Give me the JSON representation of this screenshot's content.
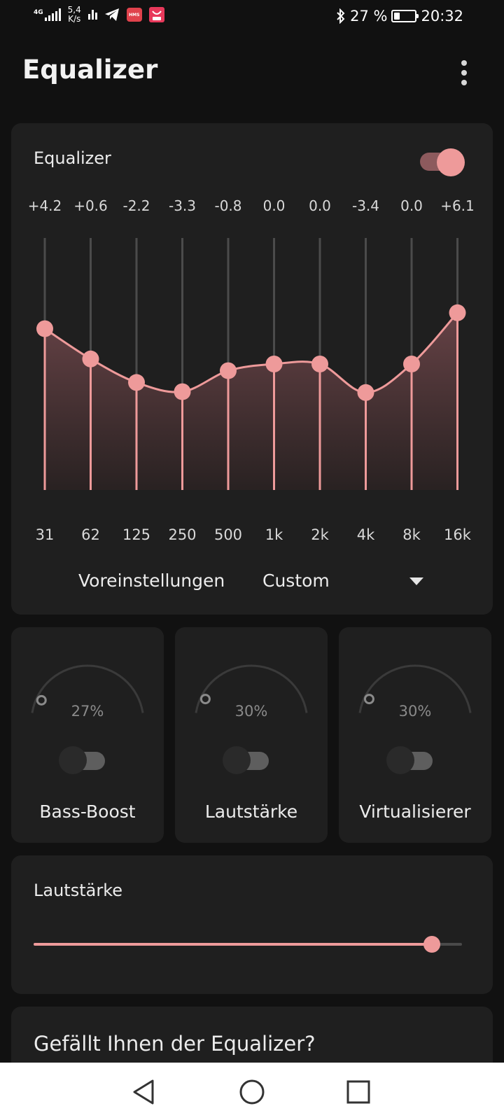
{
  "status_bar": {
    "network_type": "4G",
    "speed_value": "5,4",
    "speed_unit": "K/s",
    "hms_badge": "HMS",
    "battery_text": "27 %",
    "battery_level": 0.27,
    "time": "20:32",
    "icons": [
      "signal-icon",
      "wifi-bars-icon",
      "telegram-icon",
      "hms-icon",
      "shopping-bag-icon",
      "bluetooth-icon",
      "battery-icon"
    ]
  },
  "header": {
    "title": "Equalizer",
    "menu_icon": "more-vertical-icon"
  },
  "equalizer": {
    "title": "Equalizer",
    "enabled": true,
    "range_db": [
      -15,
      15
    ],
    "bands": [
      {
        "freq": "31",
        "value": 4.2,
        "label": "+4.2"
      },
      {
        "freq": "62",
        "value": 0.6,
        "label": "+0.6"
      },
      {
        "freq": "125",
        "value": -2.2,
        "label": "-2.2"
      },
      {
        "freq": "250",
        "value": -3.3,
        "label": "-3.3"
      },
      {
        "freq": "500",
        "value": -0.8,
        "label": "-0.8"
      },
      {
        "freq": "1k",
        "value": 0.0,
        "label": "0.0"
      },
      {
        "freq": "2k",
        "value": 0.0,
        "label": "0.0"
      },
      {
        "freq": "4k",
        "value": -3.4,
        "label": "-3.4"
      },
      {
        "freq": "8k",
        "value": 0.0,
        "label": "0.0"
      },
      {
        "freq": "16k",
        "value": 6.1,
        "label": "+6.1"
      }
    ],
    "preset_label": "Voreinstellungen",
    "preset_value": "Custom"
  },
  "effects": [
    {
      "label": "Bass-Boost",
      "percent_text": "27%",
      "level": 0.27,
      "enabled": false
    },
    {
      "label": "Lautstärke",
      "percent_text": "30%",
      "level": 0.3,
      "enabled": false
    },
    {
      "label": "Virtualisierer",
      "percent_text": "30%",
      "level": 0.3,
      "enabled": false
    }
  ],
  "volume": {
    "title": "Lautstärke",
    "level": 0.93
  },
  "rating": {
    "title": "Gefällt Ihnen der Equalizer?"
  },
  "colors": {
    "accent": "#ee9a9a",
    "card": "#1f1f1f",
    "background": "#111111"
  }
}
